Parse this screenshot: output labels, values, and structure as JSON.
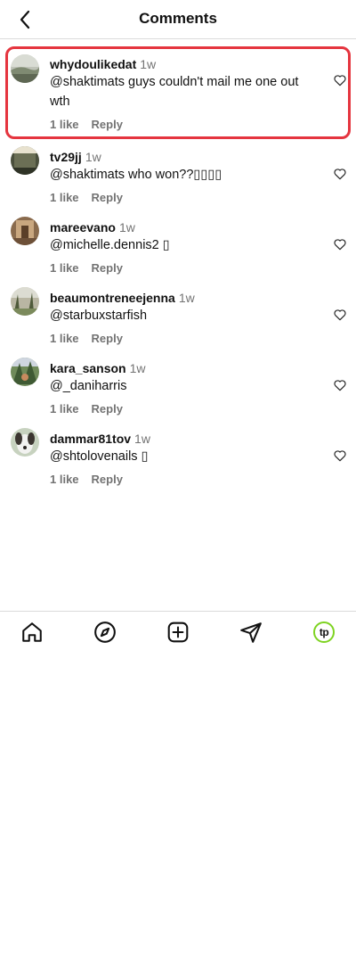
{
  "header": {
    "title": "Comments"
  },
  "comments": [
    {
      "username": "whydoulikedat",
      "time": "1w",
      "text": "@shaktimats guys couldn't mail me one out wth",
      "likes": "1 like",
      "reply": "Reply"
    },
    {
      "username": "tv29jj",
      "time": "1w",
      "text": "@shaktimats who won??▯▯▯▯",
      "likes": "1 like",
      "reply": "Reply"
    },
    {
      "username": "mareevano",
      "time": "1w",
      "text": "@michelle.dennis2 ▯",
      "likes": "1 like",
      "reply": "Reply"
    },
    {
      "username": "beaumontreneejenna",
      "time": "1w",
      "text": "@starbuxstarfish",
      "likes": "1 like",
      "reply": "Reply"
    },
    {
      "username": "kara_sanson",
      "time": "1w",
      "text": "@_daniharris",
      "likes": "1 like",
      "reply": "Reply"
    },
    {
      "username": "dammar81tov",
      "time": "1w",
      "text": "@shtolovenails ▯",
      "likes": "1 like",
      "reply": "Reply"
    }
  ],
  "tabbar": {
    "profile_logo": "tp"
  },
  "icons": [
    "back-chevron-icon",
    "heart-icon",
    "home-icon",
    "compass-icon",
    "plus-square-icon",
    "send-icon"
  ],
  "colors": {
    "highlight": "#e5353f",
    "profile_ring": "#7ed321"
  }
}
